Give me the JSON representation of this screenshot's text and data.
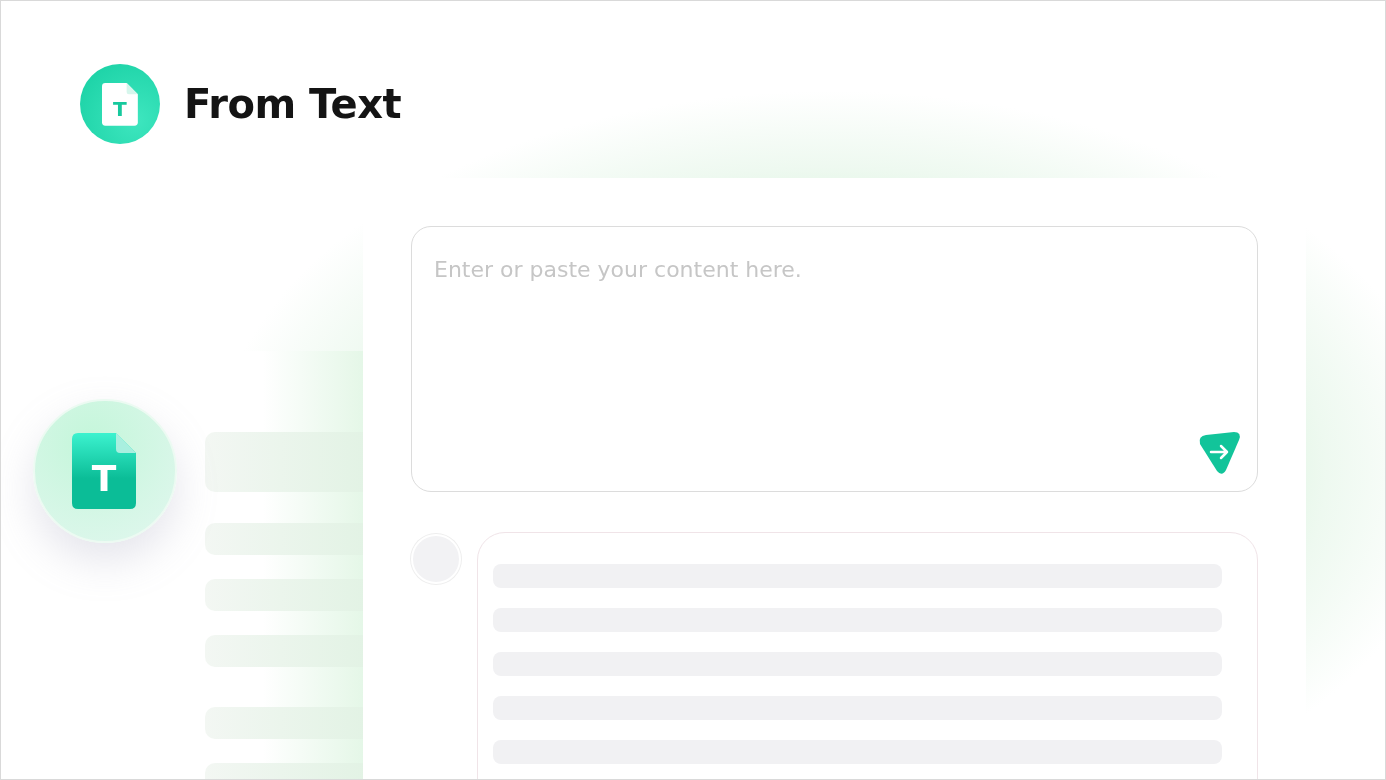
{
  "header": {
    "title": "From Text",
    "logo_letter": "T"
  },
  "badge": {
    "letter": "T"
  },
  "input": {
    "placeholder": "Enter or paste your content here."
  }
}
